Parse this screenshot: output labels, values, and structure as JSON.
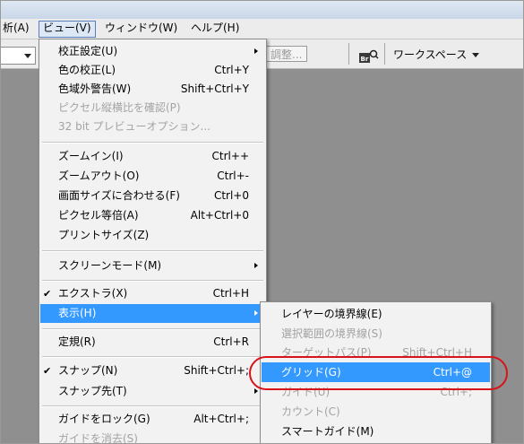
{
  "menubar": {
    "items": [
      "析(A)",
      "ビュー(V)",
      "ウィンドウ(W)",
      "ヘルプ(H)"
    ]
  },
  "optionsbar": {
    "adjust_label": "調整...",
    "workspace_label": "ワークスペース"
  },
  "view_menu": [
    {
      "label": "校正設定(U)",
      "shortcut": "",
      "submenu": true,
      "disabled": false
    },
    {
      "label": "色の校正(L)",
      "shortcut": "Ctrl+Y",
      "disabled": false
    },
    {
      "label": "色域外警告(W)",
      "shortcut": "Shift+Ctrl+Y",
      "disabled": false
    },
    {
      "label": "ピクセル縦横比を確認(P)",
      "shortcut": "",
      "disabled": true
    },
    {
      "label": "32 bit プレビューオプション...",
      "shortcut": "",
      "disabled": true
    },
    {
      "label": "ズームイン(I)",
      "shortcut": "Ctrl++",
      "disabled": false
    },
    {
      "label": "ズームアウト(O)",
      "shortcut": "Ctrl+-",
      "disabled": false
    },
    {
      "label": "画面サイズに合わせる(F)",
      "shortcut": "Ctrl+0",
      "disabled": false
    },
    {
      "label": "ピクセル等倍(A)",
      "shortcut": "Alt+Ctrl+0",
      "disabled": false
    },
    {
      "label": "プリントサイズ(Z)",
      "shortcut": "",
      "disabled": false
    },
    {
      "label": "スクリーンモード(M)",
      "shortcut": "",
      "submenu": true,
      "disabled": false
    },
    {
      "label": "エクストラ(X)",
      "shortcut": "Ctrl+H",
      "checked": true,
      "disabled": false
    },
    {
      "label": "表示(H)",
      "shortcut": "",
      "submenu": true,
      "highlighted": true
    },
    {
      "label": "定規(R)",
      "shortcut": "Ctrl+R",
      "disabled": false
    },
    {
      "label": "スナップ(N)",
      "shortcut": "Shift+Ctrl+;",
      "checked": true,
      "disabled": false
    },
    {
      "label": "スナップ先(T)",
      "shortcut": "",
      "submenu": true,
      "disabled": false
    },
    {
      "label": "ガイドをロック(G)",
      "shortcut": "Alt+Ctrl+;",
      "disabled": false
    },
    {
      "label": "ガイドを消去(S)",
      "shortcut": "",
      "disabled": true
    }
  ],
  "show_submenu": [
    {
      "label": "レイヤーの境界線(E)",
      "shortcut": "",
      "disabled": false
    },
    {
      "label": "選択範囲の境界線(S)",
      "shortcut": "",
      "disabled": true
    },
    {
      "label": "ターゲットパス(P)",
      "shortcut": "Shift+Ctrl+H",
      "disabled": true
    },
    {
      "label": "グリッド(G)",
      "shortcut": "Ctrl+@",
      "highlighted": true
    },
    {
      "label": "ガイド(U)",
      "shortcut": "Ctrl+;",
      "disabled": true
    },
    {
      "label": "カウント(C)",
      "shortcut": "",
      "disabled": true
    },
    {
      "label": "スマートガイド(M)",
      "shortcut": "",
      "disabled": false
    }
  ]
}
